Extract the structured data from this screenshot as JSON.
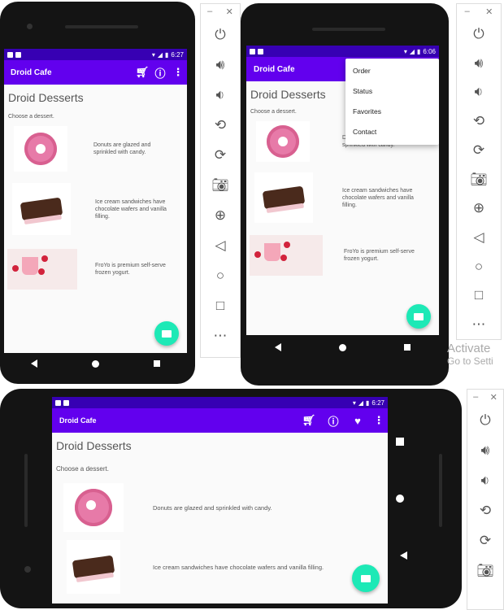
{
  "app_title": "Droid Cafe",
  "heading": "Droid Desserts",
  "subheading": "Choose a dessert.",
  "status_times": {
    "phone1": "6:27",
    "phone2": "6:06",
    "phone3": "6:27"
  },
  "desserts": [
    {
      "image": "donut-image",
      "desc": "Donuts are glazed and sprinkled with candy."
    },
    {
      "image": "ice-cream-sandwich-image",
      "desc": "Ice cream sandwiches have chocolate wafers and vanilla filling."
    },
    {
      "image": "froyo-image",
      "desc": "FroYo is premium self-serve frozen yogurt."
    }
  ],
  "overflow_menu": [
    "Order",
    "Status",
    "Favorites",
    "Contact"
  ],
  "emulator_tools": [
    "power-icon",
    "volume-up-icon",
    "volume-down-icon",
    "rotate-left-icon",
    "rotate-right-icon",
    "camera-icon",
    "zoom-icon",
    "back-icon",
    "home-icon",
    "overview-icon",
    "more-icon"
  ],
  "watermark": {
    "line1": "Activate",
    "line2": "Go to Setti"
  },
  "colors": {
    "primary": "#6200ee",
    "primary_dark": "#3700b3",
    "fab": "#1de9b6"
  }
}
